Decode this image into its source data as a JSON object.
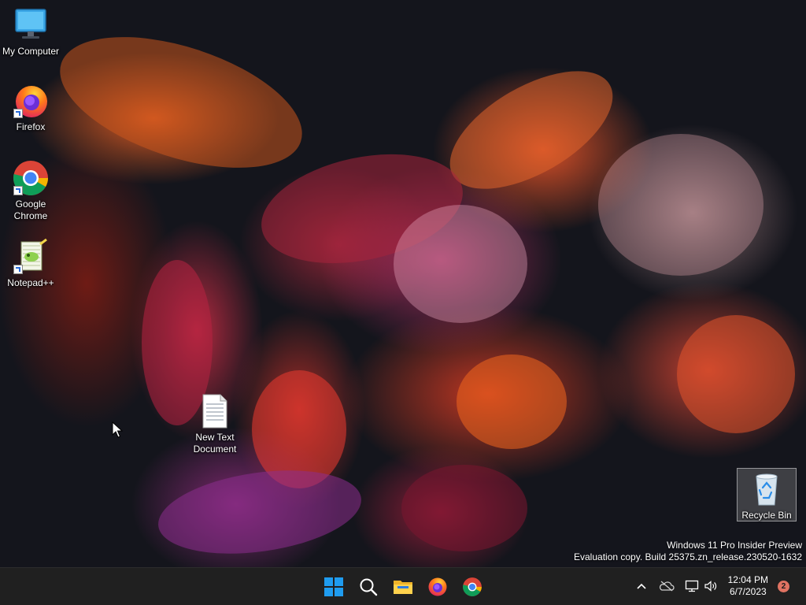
{
  "desktop": {
    "icons": [
      {
        "label": "My Computer",
        "icon": "monitor-icon"
      },
      {
        "label": "Firefox",
        "icon": "firefox-icon"
      },
      {
        "label": "Google Chrome",
        "icon": "chrome-icon"
      },
      {
        "label": "Notepad++",
        "icon": "notepadpp-icon"
      },
      {
        "label": "New Text Document",
        "icon": "text-file-icon"
      },
      {
        "label": "Recycle Bin",
        "icon": "recycle-bin-icon"
      }
    ]
  },
  "watermark": {
    "line1": "Windows 11 Pro Insider Preview",
    "line2": "Evaluation copy. Build 25375.zn_release.230520-1632"
  },
  "taskbar": {
    "pinned": [
      "start-icon",
      "search-icon",
      "file-explorer-icon",
      "firefox-icon",
      "chrome-icon"
    ],
    "tray": [
      "chevron-up-icon",
      "onedrive-offline-icon",
      "network-icon",
      "volume-icon"
    ],
    "time": "12:04 PM",
    "date": "6/7/2023",
    "notification_count": "2"
  },
  "colors": {
    "taskbar": "#202020",
    "start_blue": "#1f9cf0",
    "badge": "#e07362"
  }
}
